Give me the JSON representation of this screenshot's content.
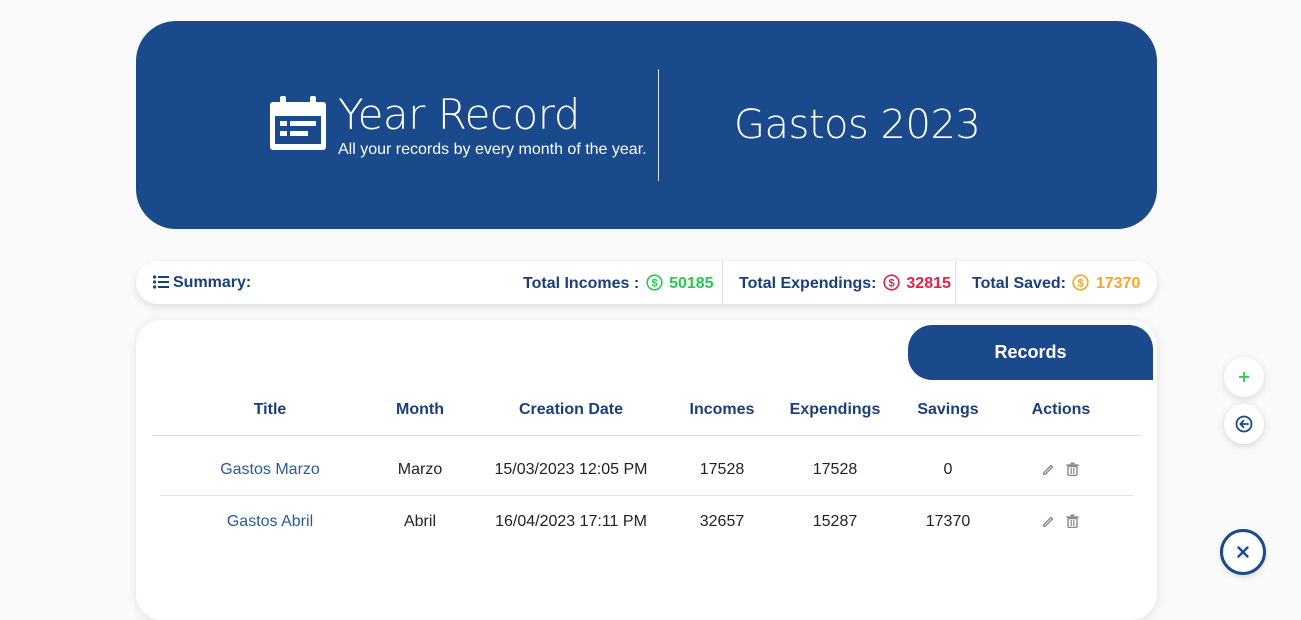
{
  "hero": {
    "title": "Year Record",
    "subtitle": "All your records by every month of the year.",
    "record_name": "Gastos 2023"
  },
  "summary": {
    "label": "Summary:",
    "incomes_label": "Total Incomes :",
    "incomes_value": "50185",
    "expendings_label": "Total Expendings:",
    "expendings_value": "32815",
    "saved_label": "Total Saved:",
    "saved_value": "17370"
  },
  "records": {
    "tab_label": "Records",
    "columns": [
      "Title",
      "Month",
      "Creation Date",
      "Incomes",
      "Expendings",
      "Savings",
      "Actions"
    ],
    "rows": [
      {
        "title": "Gastos Marzo",
        "month": "Marzo",
        "date": "15/03/2023 12:05 PM",
        "incomes": "17528",
        "expendings": "17528",
        "savings": "0"
      },
      {
        "title": "Gastos Abril",
        "month": "Abril",
        "date": "16/04/2023 17:11 PM",
        "incomes": "32657",
        "expendings": "15287",
        "savings": "17370"
      }
    ]
  },
  "colors": {
    "primary": "#1b4a8c",
    "income": "#2dc653",
    "expending": "#e6204a",
    "saved": "#f5a623"
  },
  "icons": {
    "hero": "calendar-icon",
    "summary": "list-icon",
    "coin": "dollar-coin-icon",
    "edit": "pencil-icon",
    "delete": "trash-icon",
    "add": "plus-icon",
    "back": "arrow-left-circle-icon",
    "close": "close-icon"
  }
}
